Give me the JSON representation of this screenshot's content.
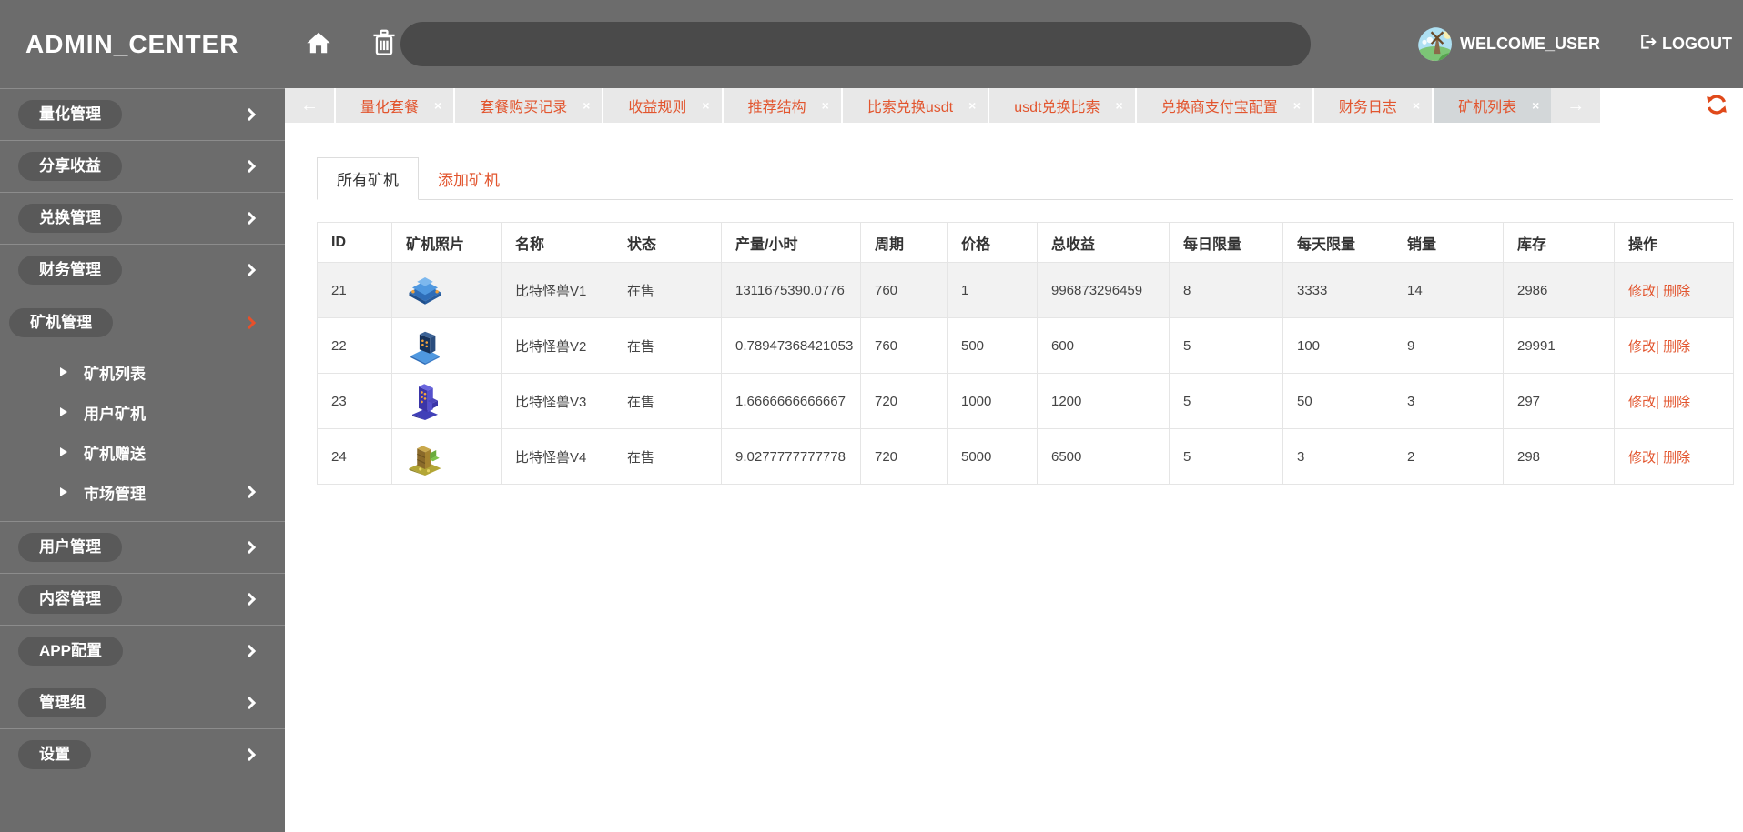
{
  "topbar": {
    "brand": "ADMIN_CENTER",
    "search_value": "",
    "username": "WELCOME_USER",
    "logout_label": "LOGOUT"
  },
  "sidebar": {
    "items": [
      {
        "label": "量化管理"
      },
      {
        "label": "分享收益"
      },
      {
        "label": "兑换管理"
      },
      {
        "label": "财务管理"
      },
      {
        "label": "矿机管理",
        "active": true,
        "children": [
          {
            "label": "矿机列表"
          },
          {
            "label": "用户矿机"
          },
          {
            "label": "矿机赠送"
          },
          {
            "label": "市场管理",
            "has_chevron": true
          }
        ]
      },
      {
        "label": "用户管理"
      },
      {
        "label": "内容管理"
      },
      {
        "label": "APP配置"
      },
      {
        "label": "管理组"
      },
      {
        "label": "设置"
      }
    ]
  },
  "tabs": {
    "scroll_left": "←",
    "scroll_right": "→",
    "close_symbol": "×",
    "items": [
      {
        "label": "量化套餐"
      },
      {
        "label": "套餐购买记录"
      },
      {
        "label": "收益规则"
      },
      {
        "label": "推荐结构"
      },
      {
        "label": "比索兑换usdt"
      },
      {
        "label": "usdt兑换比索"
      },
      {
        "label": "兑换商支付宝配置"
      },
      {
        "label": "财务日志"
      },
      {
        "label": "矿机列表",
        "active": true
      }
    ]
  },
  "main": {
    "inner_tabs": [
      {
        "label": "所有矿机",
        "active": true
      },
      {
        "label": "添加矿机"
      }
    ],
    "table": {
      "columns": [
        "ID",
        "矿机照片",
        "名称",
        "状态",
        "产量/小时",
        "周期",
        "价格",
        "总收益",
        "每日限量",
        "每天限量",
        "销量",
        "库存",
        "操作"
      ],
      "action_labels": {
        "edit": "修改",
        "divider": "|",
        "delete": "删除"
      },
      "rows": [
        {
          "id": "21",
          "image": "blue-flat-miner-image",
          "name": "比特怪兽V1",
          "status": "在售",
          "output_per_hour": "1311675390.0776",
          "cycle": "760",
          "price": "1",
          "total_income": "996873296459",
          "daily_limit": "8",
          "day_limit": "3333",
          "sales": "14",
          "stock": "2986"
        },
        {
          "id": "22",
          "image": "blue-terminal-miner-image",
          "name": "比特怪兽V2",
          "status": "在售",
          "output_per_hour": "0.78947368421053",
          "cycle": "760",
          "price": "500",
          "total_income": "600",
          "daily_limit": "5",
          "day_limit": "100",
          "sales": "9",
          "stock": "29991"
        },
        {
          "id": "23",
          "image": "purple-tower-miner-image",
          "name": "比特怪兽V3",
          "status": "在售",
          "output_per_hour": "1.6666666666667",
          "cycle": "720",
          "price": "1000",
          "total_income": "1200",
          "daily_limit": "5",
          "day_limit": "50",
          "sales": "3",
          "stock": "297"
        },
        {
          "id": "24",
          "image": "yellow-crate-miner-image",
          "name": "比特怪兽V4",
          "status": "在售",
          "output_per_hour": "9.0277777777778",
          "cycle": "720",
          "price": "5000",
          "total_income": "6500",
          "daily_limit": "5",
          "day_limit": "3",
          "sales": "2",
          "stock": "298"
        }
      ]
    }
  },
  "colors": {
    "accent": "#e2552e",
    "topbar_bg": "#6c6c6c",
    "sidebar_pill_bg": "#595959",
    "tabstrip_bg": "#e8e8e8",
    "active_tab_bg": "#d3d7d9",
    "striped_row_bg": "#f2f2f2"
  }
}
